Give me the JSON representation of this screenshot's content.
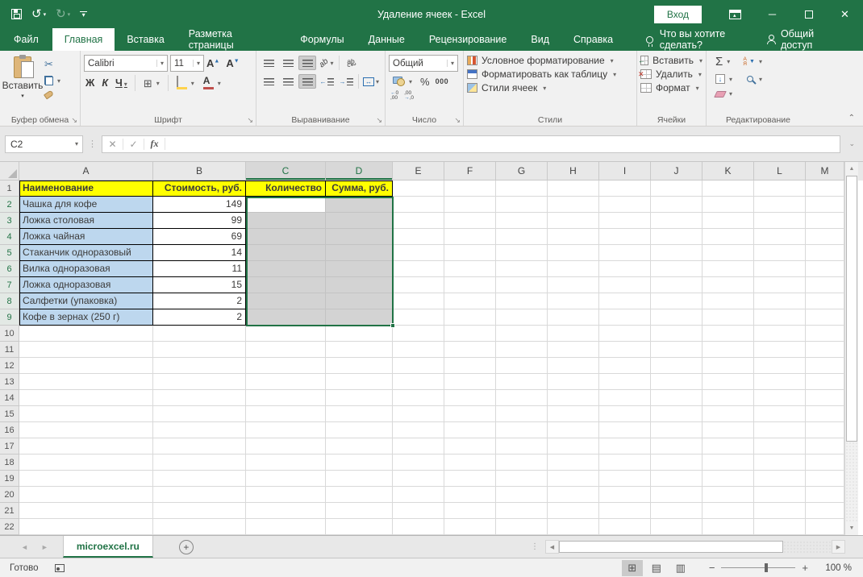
{
  "titlebar": {
    "title": "Удаление ячеек - Excel",
    "signin": "Вход"
  },
  "tabs": {
    "items": [
      "Файл",
      "Главная",
      "Вставка",
      "Разметка страницы",
      "Формулы",
      "Данные",
      "Рецензирование",
      "Вид",
      "Справка"
    ],
    "active": "Главная",
    "tellme": "Что вы хотите сделать?",
    "share": "Общий доступ"
  },
  "ribbon": {
    "clipboard": {
      "paste": "Вставить",
      "label": "Буфер обмена"
    },
    "font": {
      "name": "Calibri",
      "size": "11",
      "bold": "Ж",
      "italic": "К",
      "underline": "Ч",
      "color_letter": "А",
      "label": "Шрифт"
    },
    "alignment": {
      "label": "Выравнивание"
    },
    "number": {
      "format": "Общий",
      "percent": "%",
      "thousands": "000",
      "label": "Число"
    },
    "styles": {
      "conditional": "Условное форматирование",
      "as_table": "Форматировать как таблицу",
      "cell_styles": "Стили ячеек",
      "label": "Стили"
    },
    "cells": {
      "insert": "Вставить",
      "delete": "Удалить",
      "format": "Формат",
      "label": "Ячейки"
    },
    "editing": {
      "autosum": "Σ",
      "label": "Редактирование"
    }
  },
  "formula": {
    "name_box": "C2",
    "fx": "fx",
    "value": ""
  },
  "grid": {
    "columns": [
      "A",
      "B",
      "C",
      "D",
      "E",
      "F",
      "G",
      "H",
      "I",
      "J",
      "K",
      "L",
      "M"
    ],
    "selected_columns": [
      "C",
      "D"
    ],
    "selected_rows_from": 2,
    "selected_rows_to": 9,
    "row_count": 22,
    "active_cell": "C2",
    "header_row": {
      "A": "Наименование",
      "B": "Стоимость, руб.",
      "C": "Количество",
      "D": "Сумма, руб."
    },
    "items": [
      {
        "name": "Чашка для кофе",
        "price": "149"
      },
      {
        "name": "Ложка столовая",
        "price": "99"
      },
      {
        "name": "Ложка чайная",
        "price": "69"
      },
      {
        "name": "Стаканчик одноразовый",
        "price": "14"
      },
      {
        "name": "Вилка одноразовая",
        "price": "11"
      },
      {
        "name": "Ложка одноразовая",
        "price": "15"
      },
      {
        "name": "Салфетки (упаковка)",
        "price": "2"
      },
      {
        "name": "Кофе в зернах (250 г)",
        "price": "2"
      }
    ]
  },
  "sheetbar": {
    "tab": "microexcel.ru"
  },
  "statusbar": {
    "mode": "Готово",
    "zoom": "100 %"
  },
  "colors": {
    "accent": "#217346",
    "header_fill": "#ffff00",
    "name_fill": "#bdd7ee",
    "selection_fill": "#d3d3d3"
  }
}
